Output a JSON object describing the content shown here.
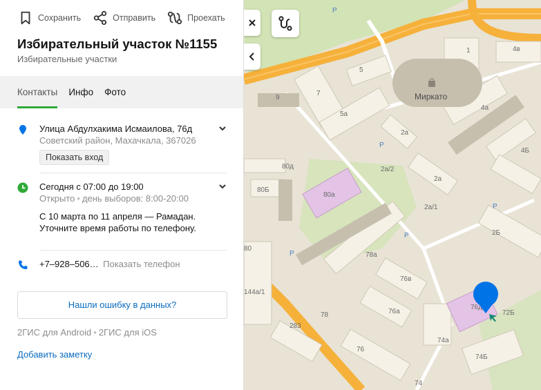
{
  "actions": {
    "save": "Сохранить",
    "share": "Отправить",
    "route": "Проехать"
  },
  "title": "Избирательный участок №1155",
  "subtitle": "Избирательные участки",
  "tabs": [
    "Контакты",
    "Инфо",
    "Фото"
  ],
  "address": {
    "street": "Улица Абдулхакима Исмаилова, 76д",
    "district": "Советский район, Махачкала, 367026",
    "entrance_button": "Показать вход"
  },
  "schedule": {
    "today": "Сегодня с 07:00 до 19:00",
    "status": "Открыто",
    "election_day": "день выборов: 8:00-20:00",
    "note_line1": "С 10 марта по 11 апреля — Рамадан.",
    "note_line2": "Уточните время работы по телефону."
  },
  "phone": {
    "number": "+7‒928‒506…",
    "show": "Показать телефон"
  },
  "error_button": "Нашли ошибку в данных?",
  "apps": {
    "android": "2ГИС для Android",
    "ios": "2ГИС для iOS"
  },
  "add_note": "Добавить заметку",
  "colors": {
    "accent_green": "#2faa37",
    "link_blue": "#0a6bbf",
    "pin_blue": "#0073e6",
    "road_orange": "#f6b13b",
    "map_bg": "#e8e3d5"
  },
  "map": {
    "labels": {
      "l1": "1",
      "l4v": "4в",
      "l5": "5",
      "l7": "7",
      "l9": "9",
      "l5a": "5а",
      "mirkato": "Миркато",
      "l4a": "4а",
      "l2a_1": "2а",
      "l2a_2": "2а",
      "l2a2": "2а/2",
      "l2a1": "2а/1",
      "l4b": "4Б",
      "l80d": "80д",
      "l80b": "80Б",
      "l80a": "80а",
      "l2b": "2Б",
      "l80": "80",
      "l78a": "78а",
      "l76v": "76в",
      "l144a": "144а/1",
      "l76a": "76а",
      "l76d": "76д",
      "l72b": "72Б",
      "l78": "78",
      "l283": "283",
      "l74a": "74а",
      "l76": "76",
      "l74b": "74Б",
      "l74": "74",
      "p1": "Р",
      "p2": "Р",
      "p3": "Р",
      "p4": "Р",
      "p5": "Р"
    }
  }
}
